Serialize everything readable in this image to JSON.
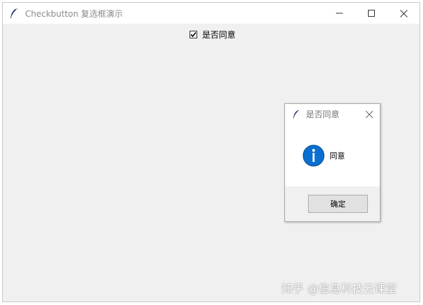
{
  "window": {
    "title": "Checkbutton 复选框演示",
    "icons": {
      "app": "feather-icon",
      "minimize": "minimize-icon",
      "maximize": "maximize-icon",
      "close": "close-icon"
    }
  },
  "checkbutton": {
    "label": "是否同意",
    "checked": true
  },
  "messagebox": {
    "title": "是否同意",
    "message": "同意",
    "ok_label": "确定",
    "icon": "info-icon",
    "accent": "#0a6fd1"
  },
  "watermark": "知乎 @信息科技云课堂"
}
